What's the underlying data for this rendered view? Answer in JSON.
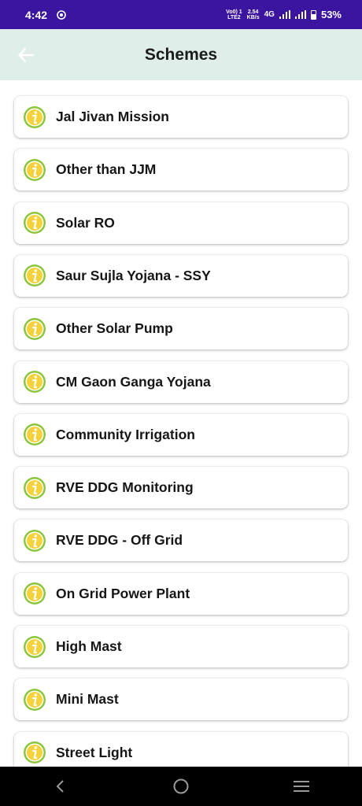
{
  "status_bar": {
    "time": "4:42",
    "volte_top": "Vo0) 1",
    "volte_bottom": "LTE2",
    "speed_top": "2.54",
    "speed_bottom": "KB/s",
    "network": "4G",
    "battery": "53%",
    "battery_level": 0.53
  },
  "app_bar": {
    "title": "Schemes",
    "back_icon": "arrow-back-icon"
  },
  "schemes": [
    {
      "label": "Jal Jivan Mission",
      "icon": "info-icon"
    },
    {
      "label": "Other than JJM",
      "icon": "info-icon"
    },
    {
      "label": "Solar RO",
      "icon": "info-icon"
    },
    {
      "label": "Saur Sujla Yojana - SSY",
      "icon": "info-icon"
    },
    {
      "label": "Other Solar Pump",
      "icon": "info-icon"
    },
    {
      "label": "CM Gaon Ganga Yojana",
      "icon": "info-icon"
    },
    {
      "label": "Community Irrigation",
      "icon": "info-icon"
    },
    {
      "label": "RVE DDG Monitoring",
      "icon": "info-icon"
    },
    {
      "label": "RVE DDG - Off Grid",
      "icon": "info-icon"
    },
    {
      "label": "On Grid Power Plant",
      "icon": "info-icon"
    },
    {
      "label": "High Mast",
      "icon": "info-icon"
    },
    {
      "label": "Mini Mast",
      "icon": "info-icon"
    },
    {
      "label": "Street Light",
      "icon": "info-icon"
    }
  ],
  "colors": {
    "status_bar": "#3b14a0",
    "app_bar": "#dfeee9",
    "icon_ring": "#8cc63e",
    "icon_fill": "#f5d23c"
  },
  "nav_bar": {
    "back": "nav-back-icon",
    "home": "nav-home-icon",
    "recents": "nav-recents-icon"
  }
}
